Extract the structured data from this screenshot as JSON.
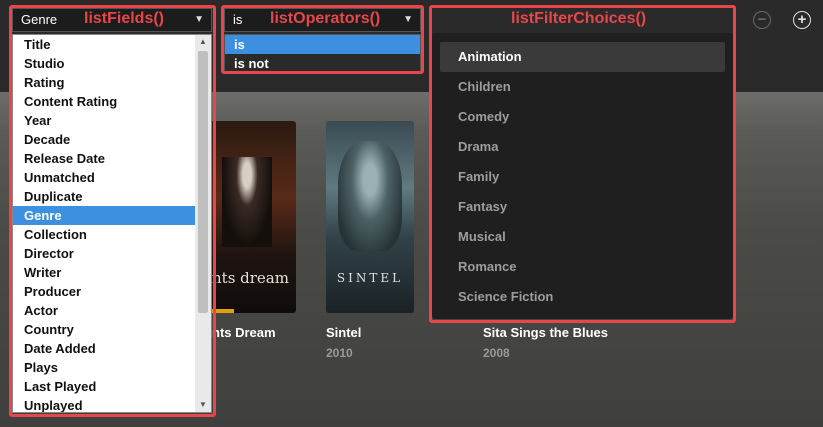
{
  "annotations": {
    "fields": "listFields()",
    "operators": "listOperators()",
    "choices": "listFilterChoices()"
  },
  "fieldSelect": {
    "value": "Genre"
  },
  "operatorSelect": {
    "value": "is"
  },
  "fieldOptions": [
    "Title",
    "Studio",
    "Rating",
    "Content Rating",
    "Year",
    "Decade",
    "Release Date",
    "Unmatched",
    "Duplicate",
    "Genre",
    "Collection",
    "Director",
    "Writer",
    "Producer",
    "Actor",
    "Country",
    "Date Added",
    "Plays",
    "Last Played",
    "Unplayed"
  ],
  "operatorOptions": [
    "is",
    "is not"
  ],
  "filterChoices": [
    "Animation",
    "Children",
    "Comedy",
    "Drama",
    "Family",
    "Fantasy",
    "Musical",
    "Romance",
    "Science Fiction"
  ],
  "items": [
    {
      "title": "nts Dream",
      "year": "",
      "poster_text": "nts dream"
    },
    {
      "title": "Sintel",
      "year": "2010",
      "poster_text": "SINTEL"
    },
    {
      "title": "Sita Sings the Blues",
      "year": "2008"
    }
  ],
  "icons": {
    "remove": "minus-circle-icon",
    "add": "plus-circle-icon"
  },
  "colors": {
    "annotation": "#e8464a",
    "selection": "#3d8fe0"
  }
}
